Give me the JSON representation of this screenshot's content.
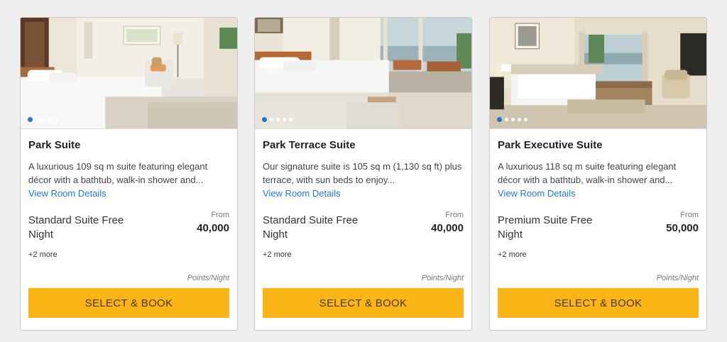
{
  "rooms": [
    {
      "name": "Park Suite",
      "description": "A luxurious 109 sq m suite featuring elegant décor with a bathtub, walk-in shower and...",
      "details_link": "View Room Details",
      "rate_name": "Standard Suite Free Night",
      "from_label": "From",
      "price": "40,000",
      "more": "+2 more",
      "unit": "Points/Night",
      "button": "SELECT & BOOK",
      "carousel": {
        "slides": 5,
        "active_index": 0
      }
    },
    {
      "name": "Park Terrace Suite",
      "description": "Our signature suite is 105 sq m (1,130 sq ft) plus terrace, with sun beds to enjoy...",
      "details_link": "View Room Details",
      "rate_name": "Standard Suite Free Night",
      "from_label": "From",
      "price": "40,000",
      "more": "+2 more",
      "unit": "Points/Night",
      "button": "SELECT & BOOK",
      "carousel": {
        "slides": 5,
        "active_index": 0
      }
    },
    {
      "name": "Park Executive Suite",
      "description": "A luxurious 118 sq m suite featuring elegant décor with a bathtub, walk-in shower and...",
      "details_link": "View Room Details",
      "rate_name": "Premium Suite Free Night",
      "from_label": "From",
      "price": "50,000",
      "more": "+2 more",
      "unit": "Points/Night",
      "button": "SELECT & BOOK",
      "carousel": {
        "slides": 5,
        "active_index": 0
      }
    }
  ],
  "colors": {
    "background": "#efefef",
    "button": "#fbb516",
    "link": "#1b7bd4",
    "active_dot": "#1b6fc8"
  }
}
